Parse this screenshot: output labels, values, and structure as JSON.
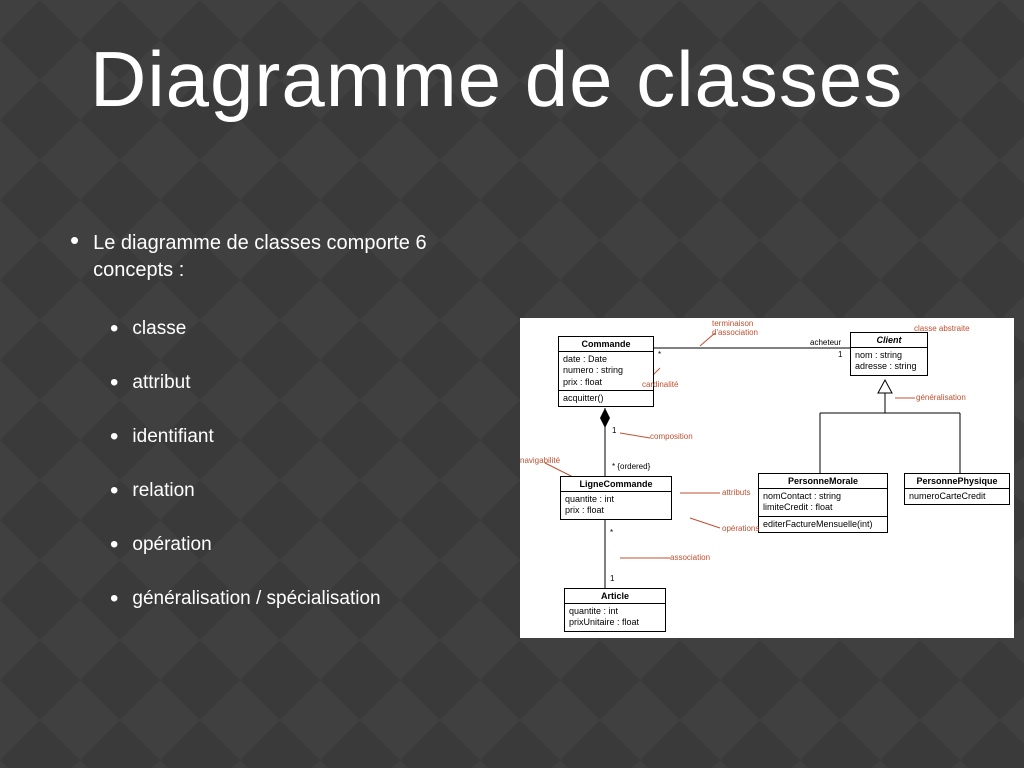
{
  "title": "Diagramme de classes",
  "intro": "Le diagramme de classes comporte 6 concepts :",
  "bullets": [
    "classe",
    "attribut",
    "identifiant",
    "relation",
    "opération",
    "généralisation / spécialisation"
  ],
  "uml": {
    "annotations": {
      "classe_abstraite": "classe abstraite",
      "terminaison": "terminaison d'association",
      "cardinalite": "cardinalité",
      "navigabilite": "navigabilité",
      "composition": "composition",
      "attributs": "attributs",
      "operations": "opérations",
      "association": "association",
      "generalisation": "généralisation",
      "ordered": "* {ordered}",
      "one": "1",
      "star": "*",
      "acheteur": "acheteur"
    },
    "classes": {
      "commande": {
        "name": "Commande",
        "attrs": "date : Date\nnumero : string\nprix : float",
        "ops": "acquitter()"
      },
      "client": {
        "name": "Client",
        "attrs": "nom : string\nadresse : string"
      },
      "ligne": {
        "name": "LigneCommande",
        "attrs": "quantite : int\nprix : float"
      },
      "morale": {
        "name": "PersonneMorale",
        "attrs": "nomContact : string\nlimiteCredit : float",
        "ops": "editerFactureMensuelle(int)"
      },
      "physique": {
        "name": "PersonnePhysique",
        "attrs": "numeroCarteCredit"
      },
      "article": {
        "name": "Article",
        "attrs": "quantite : int\nprixUnitaire : float"
      }
    }
  }
}
